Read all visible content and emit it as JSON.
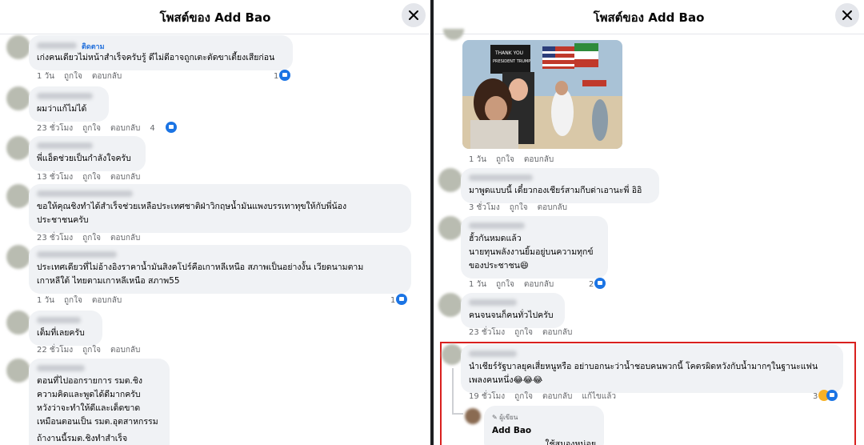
{
  "left_panel": {
    "title": "โพสต์ของ Add Bao",
    "comments": [
      {
        "follow": "ติดตาม",
        "text": [
          "เก่งคนเดียวไม่หน้าสำเร็จครับรู้ ดีไม่ดีอาจถูกเตะตัดขาเตี้ยงเสียก่อน"
        ],
        "time": "1 วัน",
        "like": "ถูกใจ",
        "reply": "ตอบกลับ",
        "reactions": "1"
      },
      {
        "text": [
          "ผมว่าแก้ไม่ได้"
        ],
        "time": "23 ชั่วโมง",
        "like": "ถูกใจ",
        "reply": "ตอบกลับ",
        "reactions": "4"
      },
      {
        "text": [
          "พี่แอ็ดช่วยเป็นกำลังใจครับ"
        ],
        "time": "13 ชั่วโมง",
        "like": "ถูกใจ",
        "reply": "ตอบกลับ",
        "reactions": ""
      },
      {
        "text": [
          "ขอให้คุณชิงทำได้สำเร็จช่วยเหลือประเทศชาติฝ่าวิกฤษน้ำมันแพงบรรเทาทุขให้กับพี่น้อง",
          "ประชาชนครับ"
        ],
        "time": "23 ชั่วโมง",
        "like": "ถูกใจ",
        "reply": "ตอบกลับ",
        "reactions": ""
      },
      {
        "text": [
          "ประเทศเดียวที่ไม่อ้างอิงราคาน้ำมันสิงคโปร์คือเกาหลีเหนือ สภาพเป็นอย่างงั้น เวียดนามตาม",
          "เกาหลีใต้ ไทยตามเกาหลีเหนือ สภาพ55"
        ],
        "time": "1 วัน",
        "like": "ถูกใจ",
        "reply": "ตอบกลับ",
        "reactions": "1"
      },
      {
        "text": [
          "เต็มที่เลยครับ"
        ],
        "time": "22 ชั่วโมง",
        "like": "ถูกใจ",
        "reply": "ตอบกลับ",
        "reactions": ""
      },
      {
        "text": [
          "ตอนที่ไปออกรายการ รมต.ชิง",
          "ความคิดและพูดได้ดีมากครับ",
          "หวังว่าจะทำให้ดีและเด็ดขาด",
          "เหมือนตอนเป็น รมต.อุตสาหกรรม",
          "ถ้างานนี้รมต.ชิงทำสำเร็จ"
        ]
      }
    ]
  },
  "right_panel": {
    "title": "โพสต์ของ Add Bao",
    "photo_sign": [
      "THANK YOU",
      "PRESIDENT TRUMP"
    ],
    "photo_meta": {
      "time": "1 วัน",
      "like": "ถูกใจ",
      "reply": "ตอบกลับ"
    },
    "comments": [
      {
        "text": [
          "มาพูดแบบนี้ เดี๋ยวกองเชียร์สามกีบด่าเอานะพี่ อิอิ"
        ],
        "time": "3 ชั่วโมง",
        "like": "ถูกใจ",
        "reply": "ตอบกลับ",
        "reactions": ""
      },
      {
        "text": [
          "ฮั้วกันหมดแล้ว",
          "นายทุนพลังงานยิ้มอยู่บนความทุกข์",
          "ของประชาชน😄"
        ],
        "time": "1 วัน",
        "like": "ถูกใจ",
        "reply": "ตอบกลับ",
        "reactions": "2"
      },
      {
        "text": [
          "คนจนจนก็คนทั่วไปครับ"
        ],
        "time": "23 ชั่วโมง",
        "like": "ถูกใจ",
        "reply": "ตอบกลับ",
        "reactions": ""
      },
      {
        "text": [
          "นำเชียร์รัฐบาลยุคเสี่ยหนูหรือ อย่าบอกนะว่าน้ำชอบคนพวกนี้ โคตรผิดหวังกับน้ำมากๆในฐานะแฟน",
          "เพลงคนหนึ่ง😂😂😂"
        ],
        "time": "19 ชั่วโมง",
        "like": "ถูกใจ",
        "reply": "ตอบกลับ",
        "edited": "แก้ไขแล้ว",
        "reactions": "3"
      }
    ],
    "author_reply": {
      "badge": "ผู้เขียน",
      "name": "Add Bao",
      "text": "ใช้สมองหน่อย"
    }
  }
}
